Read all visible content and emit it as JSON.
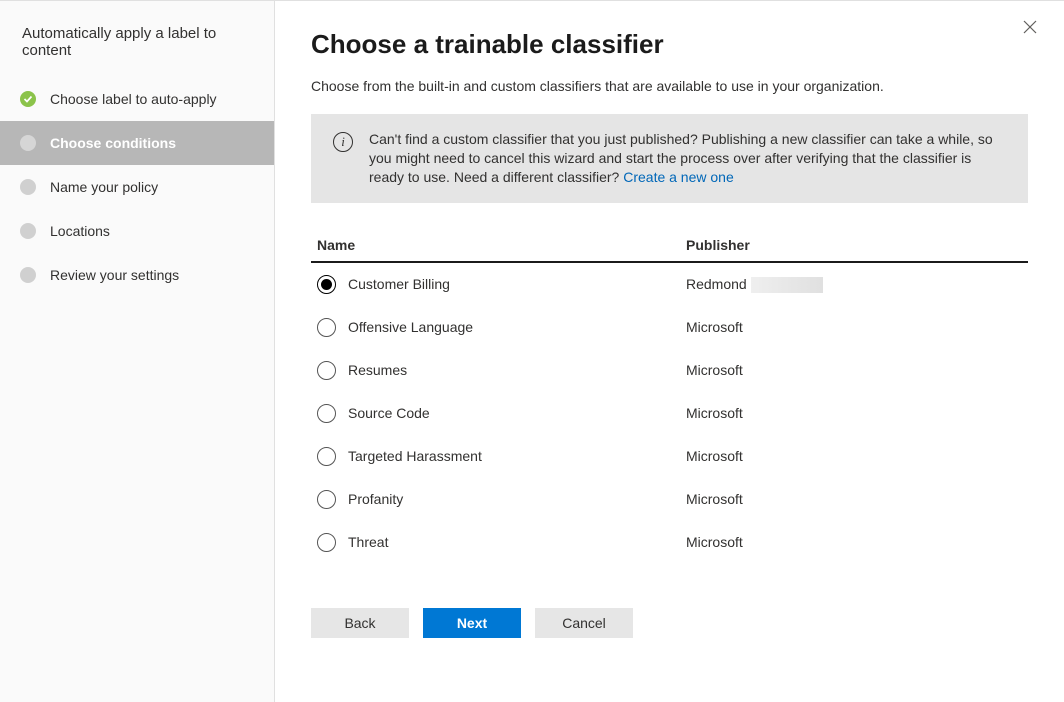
{
  "sidebar": {
    "title": "Automatically apply a label to content",
    "steps": [
      {
        "label": "Choose label to auto-apply",
        "state": "done"
      },
      {
        "label": "Choose conditions",
        "state": "active"
      },
      {
        "label": "Name your policy",
        "state": "todo"
      },
      {
        "label": "Locations",
        "state": "todo"
      },
      {
        "label": "Review your settings",
        "state": "todo"
      }
    ]
  },
  "main": {
    "title": "Choose a trainable classifier",
    "description": "Choose from the built-in and custom classifiers that are available to use in your organization.",
    "info_text": "Can't find a custom classifier that you just published? Publishing a new classifier can take a while, so you might need to cancel this wizard and start the process over after verifying that the classifier is ready to use. Need a different classifier? ",
    "info_link": "Create a new one",
    "columns": {
      "name": "Name",
      "publisher": "Publisher"
    },
    "rows": [
      {
        "name": "Customer Billing",
        "publisher": "Redmond",
        "selected": true,
        "maskPublisher": true
      },
      {
        "name": "Offensive Language",
        "publisher": "Microsoft",
        "selected": false
      },
      {
        "name": "Resumes",
        "publisher": "Microsoft",
        "selected": false
      },
      {
        "name": "Source Code",
        "publisher": "Microsoft",
        "selected": false
      },
      {
        "name": "Targeted Harassment",
        "publisher": "Microsoft",
        "selected": false
      },
      {
        "name": "Profanity",
        "publisher": "Microsoft",
        "selected": false
      },
      {
        "name": "Threat",
        "publisher": "Microsoft",
        "selected": false
      }
    ]
  },
  "footer": {
    "back": "Back",
    "next": "Next",
    "cancel": "Cancel"
  }
}
